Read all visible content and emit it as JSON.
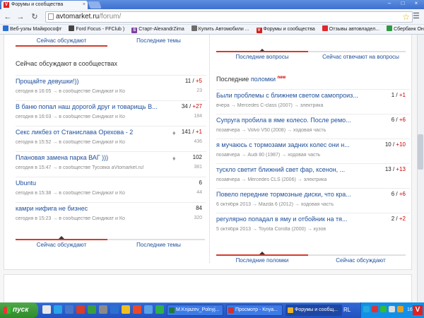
{
  "browser": {
    "tab_title": "Форумы и сообщества",
    "tab_close": "×",
    "url_domain": "avtomarket.ru",
    "url_path": "/forum/",
    "window_buttons": [
      "–",
      "□",
      "×"
    ]
  },
  "bookmarks": [
    {
      "label": "Веб-узлы Майкрософт",
      "color": "#2a6fd6",
      "icon": ""
    },
    {
      "label": "Ford Focus - FFClub )",
      "color": "#444444",
      "icon": ""
    },
    {
      "label": "Старт-AlexandrZima",
      "color": "#7b3fa0",
      "icon": "S"
    },
    {
      "label": "Купить Автомобили ...",
      "color": "#6d6d6d",
      "icon": ""
    },
    {
      "label": "Форумы и сообщества",
      "color": "#d22222",
      "icon": "V"
    },
    {
      "label": "Отзывы автовладел...",
      "color": "#e0282f",
      "icon": ""
    },
    {
      "label": "Сбербанк ОнЛ@йн",
      "color": "#2b9a3f",
      "icon": ""
    }
  ],
  "left": {
    "top_tabs": [
      "Сейчас обсуждают",
      "Последние темы"
    ],
    "title": "Сейчас обсуждают в сообществах",
    "items": [
      {
        "title": "Прощайте девушки!))",
        "meta": "сегодня в 16:05 → в сообществе Синдикат и Ко",
        "comments": "11",
        "new": "+5",
        "views": "23",
        "hot": false
      },
      {
        "title": "В баню попал наш дорогой друг и товарищь В...",
        "meta": "сегодня в 16:03 → в сообществе Синдикат и Ко",
        "comments": "34",
        "new": "+27",
        "views": "184",
        "hot": false
      },
      {
        "title": "Секс ликбез от Станислава Орехова - 2",
        "meta": "сегодня в 15:52 → в сообществе Синдикат и Ко",
        "comments": "141",
        "new": "+1",
        "views": "436",
        "hot": true
      },
      {
        "title": "Плановая замена парка ВАГ )))",
        "meta": "сегодня в 15:47 → в сообществе Тусовка aVtomarket.ru!",
        "comments": "102",
        "new": "",
        "views": "381",
        "hot": true
      },
      {
        "title": "Ubuntu",
        "meta": "сегодня в 15:38 → в сообществе Синдикат и Ко",
        "comments": "6",
        "new": "",
        "views": "44",
        "hot": false
      },
      {
        "title": "камри нифига не бизнес",
        "meta": "сегодня в 15:23 → в сообществе Синдикат и Ко",
        "comments": "84",
        "new": "",
        "views": "320",
        "hot": false
      }
    ],
    "bottom_tabs": [
      "Сейчас обсуждают",
      "Последние темы"
    ]
  },
  "right": {
    "top_tabs": [
      "Последние вопросы",
      "Сейчас отвечают на вопросы"
    ],
    "title_prefix": "Последние",
    "title_link": "поломки",
    "title_badge": "new",
    "items": [
      {
        "title": "Были проблемы с ближнем светом самопроиз...",
        "meta": "вчера → Mercedes C-class (2007) → электрика",
        "comments": "1",
        "new": "+1"
      },
      {
        "title": "Супруга пробила в яме колесо. После ремо...",
        "meta": "позавчера → Volvo V50 (2008) → ходовая часть",
        "comments": "6",
        "new": "+6"
      },
      {
        "title": "я мучаюсь с тормозами задних колес они н...",
        "meta": "позавчера → Audi 80 (1987) → ходовая часть",
        "comments": "10",
        "new": "+10"
      },
      {
        "title": "тускло светит ближний свет фар, ксенон, ...",
        "meta": "позавчера → Mercedes CLS (2006) → электрика",
        "comments": "13",
        "new": "+13"
      },
      {
        "title": "Повело передние тормозные диски, что кра...",
        "meta": "6 октября 2013 → Mazda 6 (2012) → ходовая часть",
        "comments": "6",
        "new": "+6"
      },
      {
        "title": "регулярно попадал в яму и отбойник на тя...",
        "meta": "5 октября 2013 → Toyota Corolla (2000) → кузов",
        "comments": "2",
        "new": "+2"
      }
    ],
    "bottom_tabs": [
      "Последние поломки",
      "Сейчас обсуждают"
    ]
  },
  "taskbar": {
    "start_label": "пуск",
    "tasks": [
      {
        "label": "M.Knjazev_Polnyj...",
        "color": "#1f7a3a",
        "active": false
      },
      {
        "label": "Просмотр - Knya...",
        "color": "#d0302f",
        "active": false
      },
      {
        "label": "Форумы и сообщ...",
        "color": "#e8b324",
        "active": true
      }
    ],
    "lang": "RL",
    "clock": "16"
  }
}
